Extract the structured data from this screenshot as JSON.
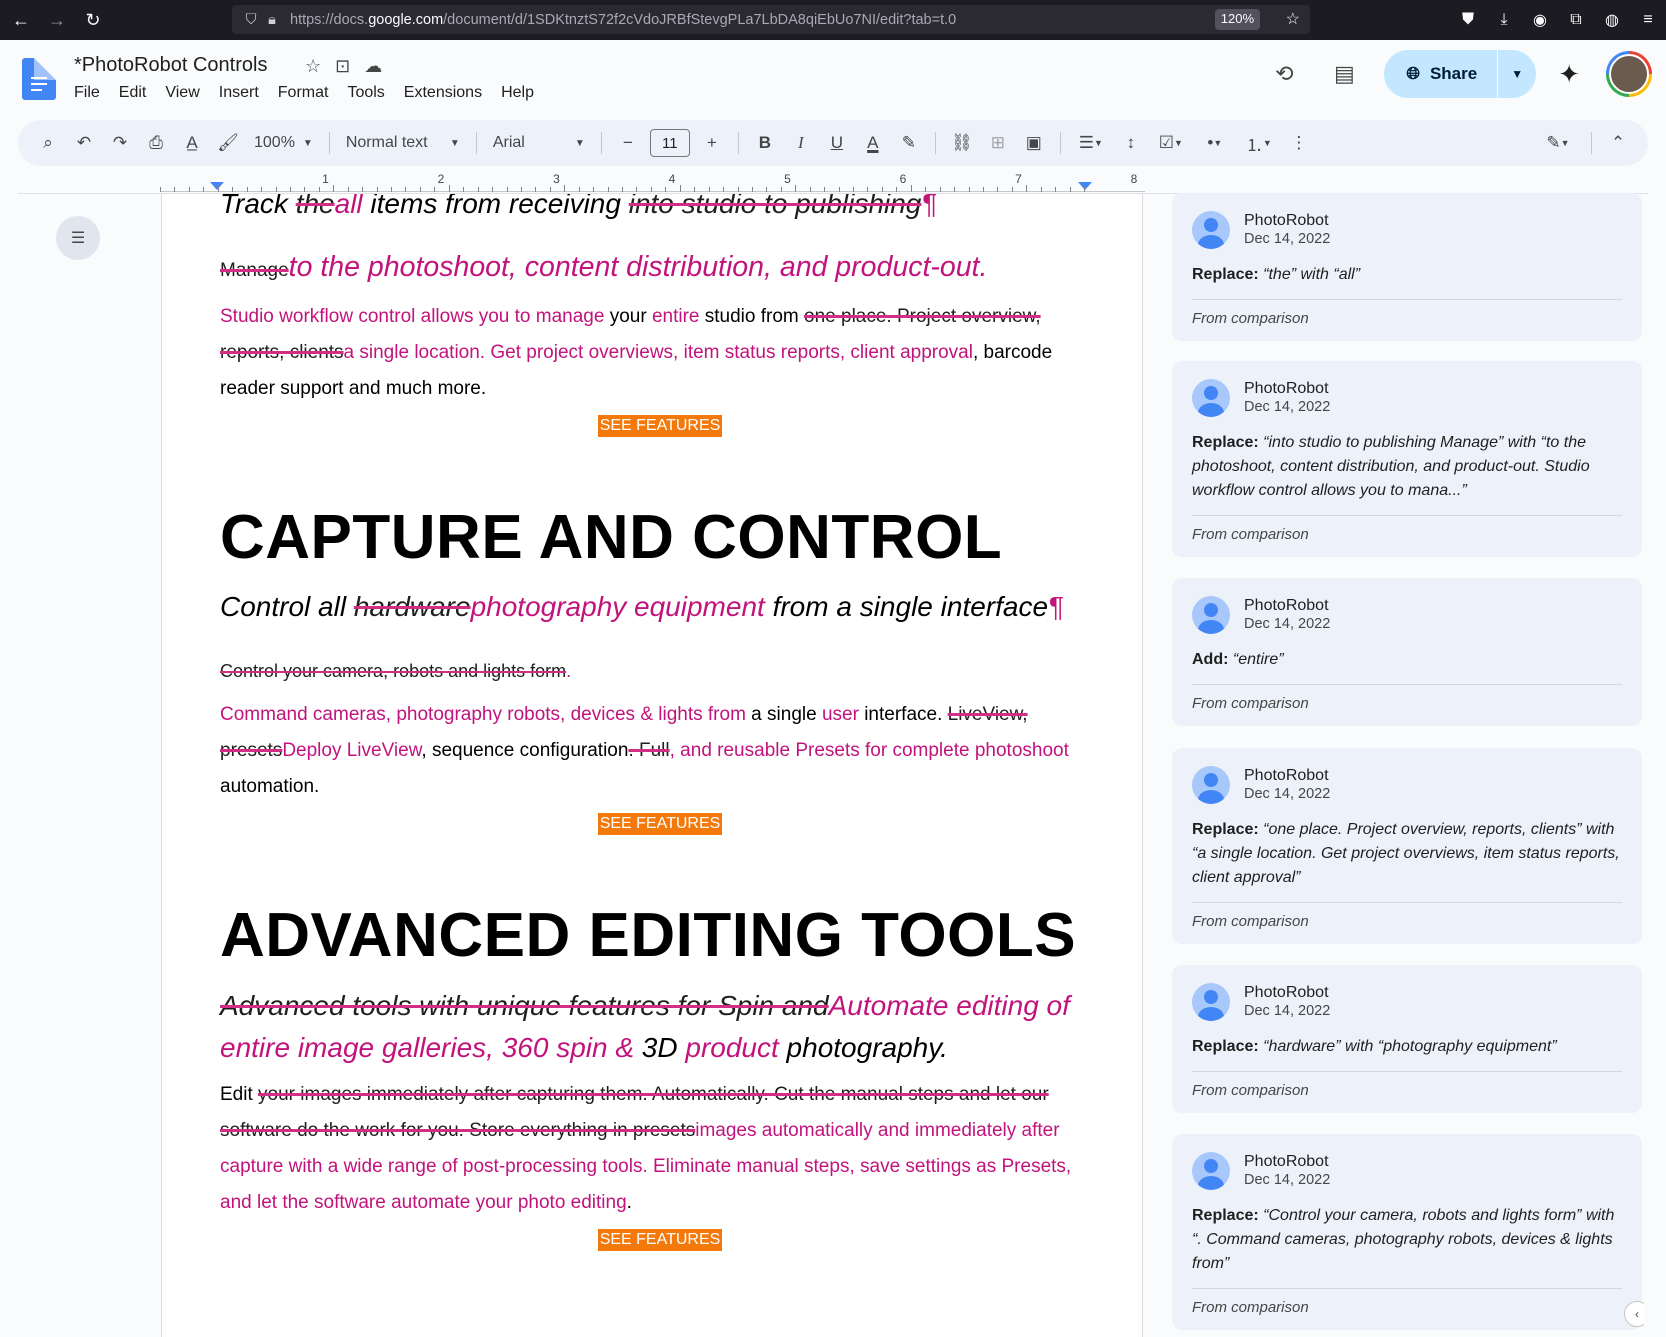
{
  "browser": {
    "url_prefix": "https://docs.",
    "url_domain": "google.com",
    "url_path": "/document/d/1SDKtnztS72f2cVdoJRBfStevgPLa7LbDA8qiEbUo7NI/edit?tab=t.0",
    "zoom": "120%"
  },
  "docs": {
    "title": "*PhotoRobot Controls",
    "menus": [
      "File",
      "Edit",
      "View",
      "Insert",
      "Format",
      "Tools",
      "Extensions",
      "Help"
    ],
    "share_label": "Share"
  },
  "toolbar": {
    "zoom": "100%",
    "style": "Normal text",
    "font": "Arial",
    "font_size": "11"
  },
  "ruler": {
    "numbers": [
      "1",
      "2",
      "3",
      "4",
      "5",
      "6",
      "7",
      "8"
    ]
  },
  "document": {
    "s1_line1": {
      "a": "Track ",
      "b": "the",
      "c": "all",
      "d": " items from receiving ",
      "e": "into studio to publishing",
      "f": "¶"
    },
    "s1_line2": {
      "a": "Manage",
      "b": "to the photoshoot, content distribution, and product-out."
    },
    "s1_para": {
      "a": "Studio workflow control allows you to manage",
      "b": " your ",
      "c": "entire",
      "d": " studio from ",
      "e": "one place. Project overview, reports, clients",
      "f": "a single location. Get project overviews, item status reports, client approval",
      "g": ", barcode reader support and much more."
    },
    "see_features": "SEE FEATURES",
    "h_capture": "CAPTURE AND CONTROL",
    "s2_sub": {
      "a": "Control all ",
      "b": "hardware",
      "c": "photography equipment",
      "d": " from a single interface",
      "e": "¶"
    },
    "s2_del": "Control your camera, robots and lights form",
    "s2_del_dot": ".",
    "s2_para": {
      "a": "Command cameras, photography robots, devices & lights from",
      "b": " a single ",
      "c": "user",
      "d": " interface. ",
      "e": "LiveView, presets",
      "f": "Deploy LiveView",
      "g": ", sequence configuration",
      "h": ". Full",
      "i": ", and reusable Presets for complete photoshoot",
      "j": " automation."
    },
    "h_advanced": "ADVANCED EDITING TOOLS",
    "s3_sub": {
      "a": "Advanced tools with unique features for Spin and",
      "b": "Automate editing of entire image galleries, 360 spin & ",
      "c": "3D ",
      "d": "product",
      "e": " photography."
    },
    "s3_para": {
      "a": "Edit ",
      "b": "your images immediately after capturing them. Automatically. Cut the manual steps and let our software do the work for you. Store everything in presets",
      "c": "images automatically and immediately after capture with a wide range of post-processing tools. Eliminate manual steps, save settings as Presets, and let the software automate your photo editing",
      "d": "."
    }
  },
  "comments": [
    {
      "author": "PhotoRobot",
      "date": "Dec 14, 2022",
      "kind": "Replace:",
      "text": "“the” with “all”",
      "footer": "From comparison"
    },
    {
      "author": "PhotoRobot",
      "date": "Dec 14, 2022",
      "kind": "Replace:",
      "text": "“into studio to publishing Manage” with “to the photoshoot, content distribution, and product-out. Studio workflow control allows you to mana...”",
      "footer": "From comparison"
    },
    {
      "author": "PhotoRobot",
      "date": "Dec 14, 2022",
      "kind": "Add:",
      "text": "“entire”",
      "footer": "From comparison"
    },
    {
      "author": "PhotoRobot",
      "date": "Dec 14, 2022",
      "kind": "Replace:",
      "text": "“one place. Project overview, reports, clients” with “a single location. Get project overviews, item status reports, client approval”",
      "footer": "From comparison"
    },
    {
      "author": "PhotoRobot",
      "date": "Dec 14, 2022",
      "kind": "Replace:",
      "text": "“hardware” with “photography equipment”",
      "footer": "From comparison"
    },
    {
      "author": "PhotoRobot",
      "date": "Dec 14, 2022",
      "kind": "Replace:",
      "text": "“Control your camera, robots and lights form” with “. Command cameras, photography robots, devices & lights from”",
      "footer": "From comparison"
    }
  ],
  "colors": {
    "inserted": "#c2137c",
    "see_features_bg": "#f4790b",
    "share_bg": "#c2e7ff"
  }
}
